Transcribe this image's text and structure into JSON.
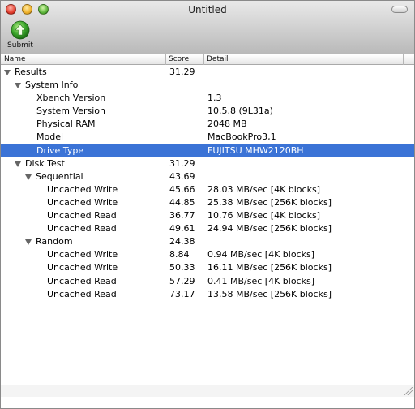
{
  "window": {
    "title": "Untitled"
  },
  "toolbar": {
    "submit_label": "Submit",
    "submit_icon": "up-arrow-green-icon"
  },
  "columns": {
    "name": "Name",
    "score": "Score",
    "detail": "Detail"
  },
  "rows": [
    {
      "name": "Results",
      "score": "31.29",
      "detail": "",
      "depth": 0,
      "disclosure": true
    },
    {
      "name": "System Info",
      "score": "",
      "detail": "",
      "depth": 1,
      "disclosure": true
    },
    {
      "name": "Xbench Version",
      "score": "",
      "detail": "1.3",
      "depth": 2,
      "disclosure": false
    },
    {
      "name": "System Version",
      "score": "",
      "detail": "10.5.8 (9L31a)",
      "depth": 2,
      "disclosure": false
    },
    {
      "name": "Physical RAM",
      "score": "",
      "detail": "2048 MB",
      "depth": 2,
      "disclosure": false
    },
    {
      "name": "Model",
      "score": "",
      "detail": "MacBookPro3,1",
      "depth": 2,
      "disclosure": false
    },
    {
      "name": "Drive Type",
      "score": "",
      "detail": "FUJITSU MHW2120BH",
      "depth": 2,
      "disclosure": false,
      "selected": true
    },
    {
      "name": "Disk Test",
      "score": "31.29",
      "detail": "",
      "depth": 1,
      "disclosure": true
    },
    {
      "name": "Sequential",
      "score": "43.69",
      "detail": "",
      "depth": 2,
      "disclosure": true
    },
    {
      "name": "Uncached Write",
      "score": "45.66",
      "detail": "28.03 MB/sec [4K blocks]",
      "depth": 3,
      "disclosure": false
    },
    {
      "name": "Uncached Write",
      "score": "44.85",
      "detail": "25.38 MB/sec [256K blocks]",
      "depth": 3,
      "disclosure": false
    },
    {
      "name": "Uncached Read",
      "score": "36.77",
      "detail": "10.76 MB/sec [4K blocks]",
      "depth": 3,
      "disclosure": false
    },
    {
      "name": "Uncached Read",
      "score": "49.61",
      "detail": "24.94 MB/sec [256K blocks]",
      "depth": 3,
      "disclosure": false
    },
    {
      "name": "Random",
      "score": "24.38",
      "detail": "",
      "depth": 2,
      "disclosure": true
    },
    {
      "name": "Uncached Write",
      "score": "8.84",
      "detail": "0.94 MB/sec [4K blocks]",
      "depth": 3,
      "disclosure": false
    },
    {
      "name": "Uncached Write",
      "score": "50.33",
      "detail": "16.11 MB/sec [256K blocks]",
      "depth": 3,
      "disclosure": false
    },
    {
      "name": "Uncached Read",
      "score": "57.29",
      "detail": "0.41 MB/sec [4K blocks]",
      "depth": 3,
      "disclosure": false
    },
    {
      "name": "Uncached Read",
      "score": "73.17",
      "detail": "13.58 MB/sec [256K blocks]",
      "depth": 3,
      "disclosure": false
    }
  ],
  "colors": {
    "selection": "#3b73d6",
    "disclosure": "#666666"
  }
}
